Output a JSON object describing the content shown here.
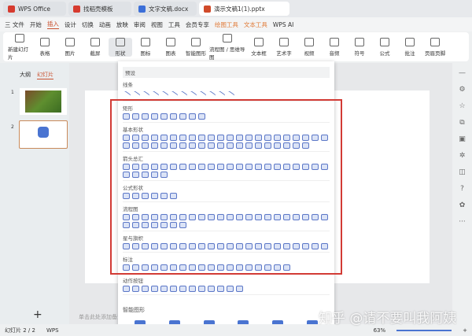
{
  "tabs": [
    {
      "label": "WPS Office",
      "color": "#d63b2f"
    },
    {
      "label": "找稻壳模板",
      "color": "#d63b2f"
    },
    {
      "label": "文字文稿.docx",
      "color": "#3c6fd8"
    },
    {
      "label": "演示文稿1(1).pptx",
      "color": "#d04a2a"
    }
  ],
  "menu": [
    "三 文件",
    "开始",
    "插入",
    "设计",
    "切换",
    "动画",
    "放映",
    "审阅",
    "视图",
    "工具",
    "会员专享",
    "绘图工具",
    "文本工具",
    "WPS AI"
  ],
  "ribbon": [
    "新建幻灯片",
    "表格",
    "图片",
    "截屏",
    "形状",
    "图标",
    "图表",
    "智能图形",
    "流程图 / 思维导图",
    "文本框",
    "艺术字",
    "视频",
    "音频",
    "符号",
    "公式",
    "批注",
    "页眉页脚"
  ],
  "left_panel": {
    "tabs": [
      "大纲",
      "幻灯片"
    ],
    "slide_numbers": [
      "1",
      "2"
    ]
  },
  "dropdown": {
    "sections": [
      {
        "title": "预设",
        "count": 0
      },
      {
        "title": "线条",
        "count": 12,
        "line": true
      },
      {
        "title": "矩形",
        "count": 9
      },
      {
        "title": "基本形状",
        "count": 42
      },
      {
        "title": "箭头总汇",
        "count": 27
      },
      {
        "title": "公式形状",
        "count": 6
      },
      {
        "title": "流程图",
        "count": 29
      },
      {
        "title": "星与旗帜",
        "count": 22
      },
      {
        "title": "标注",
        "count": 18
      },
      {
        "title": "动作按钮",
        "count": 13
      }
    ],
    "smart_title": "智能图形"
  },
  "notes_placeholder": "单击此处添加备注",
  "status": {
    "slide": "幻灯片 2 / 2",
    "app": "WPS",
    "zoom": "63%"
  },
  "watermark": "知乎 @请不要叫我阿姨"
}
